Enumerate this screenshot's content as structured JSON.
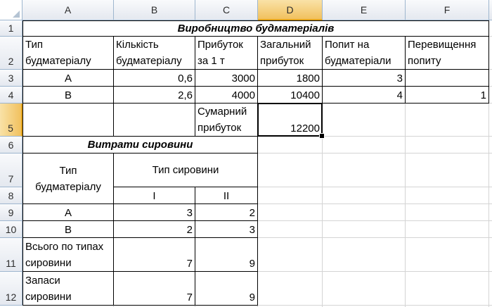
{
  "sheet": {
    "columns": [
      "A",
      "B",
      "C",
      "D",
      "E",
      "F"
    ],
    "rows": [
      "1",
      "2",
      "3",
      "4",
      "5",
      "6",
      "7",
      "8",
      "9",
      "10",
      "11",
      "12"
    ],
    "selected_column": "D",
    "selected_row": "5"
  },
  "table1": {
    "title": "Виробництво будматеріалів",
    "headers": [
      [
        "Тип",
        "будматеріалу"
      ],
      [
        "Кількість",
        "будматеріалу"
      ],
      [
        "Прибуток",
        "за 1 т"
      ],
      [
        "Загальний",
        "прибуток"
      ],
      [
        "Попит на",
        "будматеріали"
      ],
      [
        "Перевищення",
        "попиту"
      ]
    ],
    "rows": [
      {
        "type": "A",
        "qty": "0,6",
        "profit": "3000",
        "total": "1800",
        "demand": "3",
        "excess": ""
      },
      {
        "type": "B",
        "qty": "2,6",
        "profit": "4000",
        "total": "10400",
        "demand": "4",
        "excess": "1"
      }
    ],
    "sum_label": [
      "Сумарний",
      "прибуток"
    ],
    "sum_value": "12200"
  },
  "table2": {
    "title": "Витрати сировини",
    "type_header": [
      "Тип",
      "будматеріалу"
    ],
    "raw_header": "Тип сировини",
    "raw_types": [
      "I",
      "II"
    ],
    "rows": [
      {
        "label": "A",
        "v1": "3",
        "v2": "2"
      },
      {
        "label": "B",
        "v1": "2",
        "v2": "3"
      }
    ],
    "total_label": [
      "Всього по типах",
      "сировини"
    ],
    "total_values": [
      "7",
      "9"
    ],
    "stock_label": [
      "Запаси",
      "сировини"
    ],
    "stock_values": [
      "7",
      "9"
    ]
  }
}
